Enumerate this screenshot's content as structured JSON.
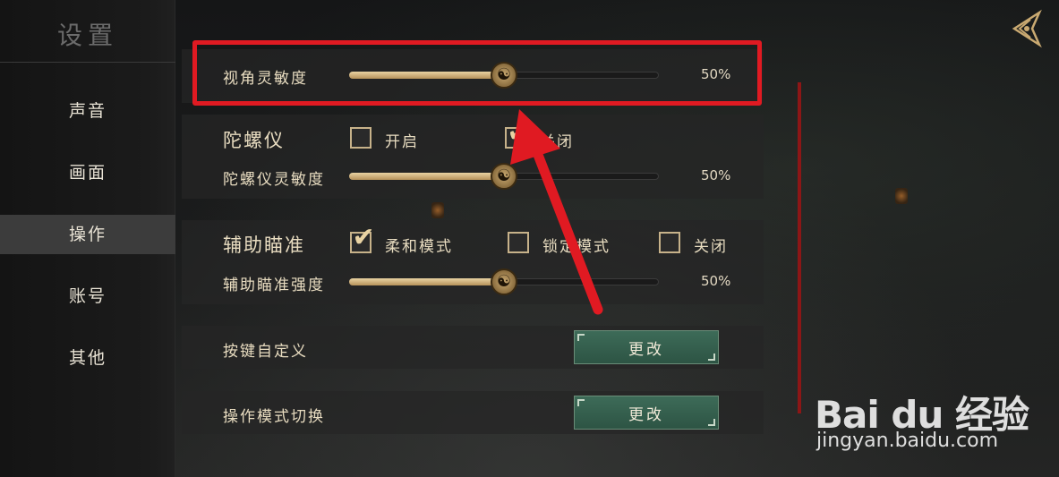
{
  "sidebar": {
    "title": "设置",
    "items": [
      {
        "label": "声音"
      },
      {
        "label": "画面"
      },
      {
        "label": "操作"
      },
      {
        "label": "账号"
      },
      {
        "label": "其他"
      }
    ],
    "active_index": 2
  },
  "settings": {
    "view_sensitivity": {
      "label": "视角灵敏度",
      "value": 50,
      "value_text": "50%"
    },
    "gyroscope": {
      "label": "陀螺仪",
      "options": [
        {
          "label": "开启",
          "checked": false
        },
        {
          "label": "关闭",
          "checked": true
        }
      ],
      "sensitivity": {
        "label": "陀螺仪灵敏度",
        "value": 50,
        "value_text": "50%"
      }
    },
    "aim_assist": {
      "label": "辅助瞄准",
      "options": [
        {
          "label": "柔和模式",
          "checked": true
        },
        {
          "label": "锁定模式",
          "checked": false
        },
        {
          "label": "关闭",
          "checked": false
        }
      ],
      "strength": {
        "label": "辅助瞄准强度",
        "value": 50,
        "value_text": "50%"
      }
    },
    "key_custom": {
      "label": "按键自定义",
      "button": "更改"
    },
    "mode_switch": {
      "label": "操作模式切换",
      "button": "更改"
    }
  },
  "watermark": {
    "logo": "Bai du 经验",
    "url": "jingyan.baidu.com"
  },
  "colors": {
    "highlight": "#e01a22",
    "accent_gold": "#e9d3a3",
    "button_green": "#3d6b58"
  }
}
